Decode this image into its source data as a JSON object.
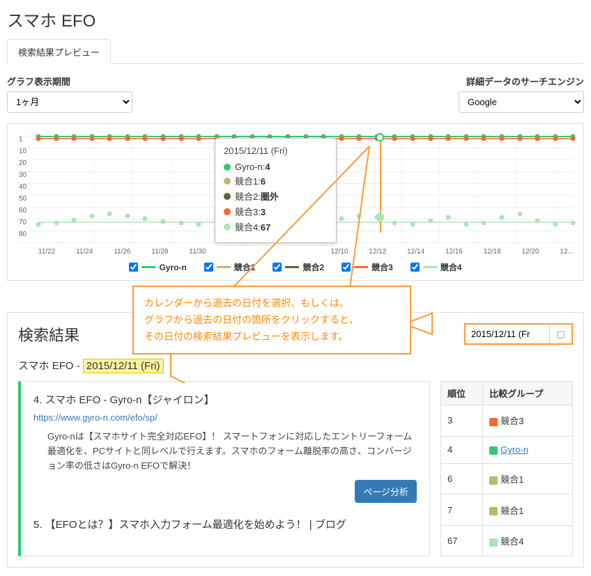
{
  "page_title": "スマホ EFO",
  "tab_label": "検索結果プレビュー",
  "controls": {
    "period_label": "グラフ表示期間",
    "period_value": "1ヶ月",
    "engine_label": "詳細データのサーチエンジン",
    "engine_value": "Google"
  },
  "chart_data": {
    "type": "line",
    "title": "",
    "xlabel": "",
    "ylabel": "",
    "ylim": [
      1,
      80
    ],
    "y_ticks": [
      "1",
      "10",
      "20",
      "30",
      "40",
      "50",
      "60",
      "70",
      "80"
    ],
    "x_ticks": [
      "11/22",
      "11/24",
      "11/26",
      "11/28",
      "11/30",
      "",
      "",
      "",
      "",
      "",
      "12/10",
      "12/12",
      "12/14",
      "12/16",
      "12/18",
      "12/20",
      "12..."
    ],
    "series": [
      {
        "name": "Gyro-n",
        "color": "#2ecc71",
        "approx_value": 4
      },
      {
        "name": "競合1",
        "color": "#bdb76b",
        "approx_value": 6
      },
      {
        "name": "競合2",
        "color": "#556b2f",
        "approx_value": "圏外"
      },
      {
        "name": "競合3",
        "color": "#ff6633",
        "approx_value": 3
      },
      {
        "name": "競合4",
        "color": "#a8e6b8",
        "approx_value": 67
      }
    ],
    "marker_date": "2015/12/11 (Fri)"
  },
  "tooltip": {
    "date": "2015/12/11 (Fri)",
    "rows": [
      {
        "label": "Gyro-n",
        "value": "4",
        "color": "#2ecc71"
      },
      {
        "label": "競合1",
        "value": "6",
        "color": "#bdb76b"
      },
      {
        "label": "競合2",
        "value": "圏外",
        "color": "#556b2f"
      },
      {
        "label": "競合3",
        "value": "3",
        "color": "#ff6633"
      },
      {
        "label": "競合4",
        "value": "67",
        "color": "#a8e6b8"
      }
    ]
  },
  "legend": [
    "Gyro-n",
    "競合1",
    "競合2",
    "競合3",
    "競合4"
  ],
  "legend_colors": [
    "#2ecc71",
    "#bdb76b",
    "#556b2f",
    "#ff6633",
    "#a8e6b8"
  ],
  "callout": {
    "line1": "カレンダーから過去の日付を選択、もしくは、",
    "line2": "グラフから過去の日付の箇所をクリックすると、",
    "line3": "その日付の検索結果プレビューを表示します。"
  },
  "results": {
    "heading": "検索結果",
    "subtitle_prefix": "スマホ EFO - ",
    "subtitle_date": "2015/12/11 (Fri)",
    "date_input": "2015/12/11 (Fr",
    "items": [
      {
        "title": "4. スマホ EFO - Gyro-n【ジャイロン】",
        "url": "https://www.gyro-n.com/efo/sp/",
        "desc": "Gyro-nは【スマホサイト完全対応EFO】！ スマートフォンに対応したエントリーフォーム最適化を、PCサイトと同レベルで行えます。スマホのフォーム離脱率の高さ、コンバージョン率の低さはGyro-n EFOで解決！",
        "button": "ページ分析"
      },
      {
        "title": "5. 【EFOとは？】スマホ入力フォーム最適化を始めよう！ | ブログ"
      }
    ]
  },
  "rank_table": {
    "headers": [
      "順位",
      "比較グループ"
    ],
    "rows": [
      {
        "rank": "3",
        "group": "競合3",
        "color": "#ff6633"
      },
      {
        "rank": "4",
        "group": "Gyro-n",
        "color": "#2ecc71",
        "link": true
      },
      {
        "rank": "6",
        "group": "競合1",
        "color": "#bdb76b"
      },
      {
        "rank": "7",
        "group": "競合1",
        "color": "#bdb76b"
      },
      {
        "rank": "67",
        "group": "競合4",
        "color": "#a8e6b8"
      }
    ]
  }
}
